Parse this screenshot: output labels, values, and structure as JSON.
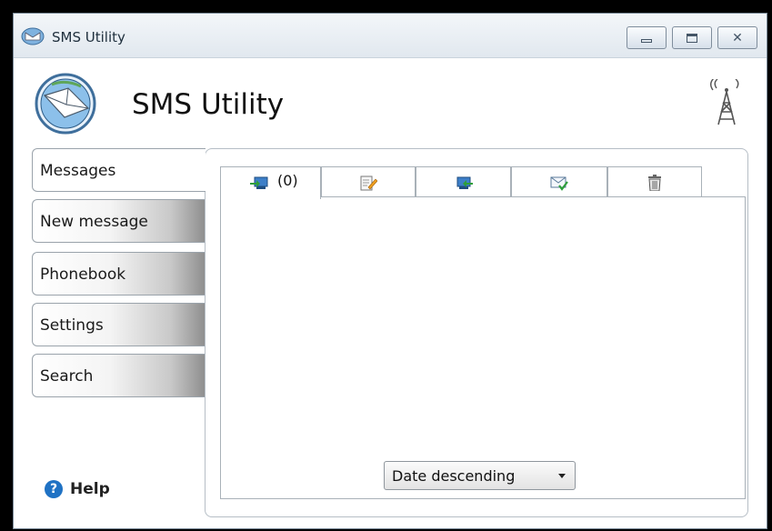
{
  "window": {
    "title": "SMS Utility",
    "controls": [
      "minimize-icon",
      "maximize-icon",
      "close-icon"
    ]
  },
  "header": {
    "app_title": "SMS Utility",
    "logo_icon": "envelope-globe-icon",
    "signal_icon": "signal-tower-icon"
  },
  "sidebar": {
    "items": [
      {
        "label": "Messages",
        "active": true
      },
      {
        "label": "New message",
        "active": false
      },
      {
        "label": "Phonebook",
        "active": false
      },
      {
        "label": "Settings",
        "active": false
      },
      {
        "label": "Search",
        "active": false
      }
    ],
    "help_label": "Help",
    "help_icon": "help-icon"
  },
  "messages": {
    "tabs": [
      {
        "icon": "inbox-icon",
        "count": "(0)",
        "active": true
      },
      {
        "icon": "drafts-icon",
        "active": false
      },
      {
        "icon": "outbox-icon",
        "active": false
      },
      {
        "icon": "sent-icon",
        "active": false
      },
      {
        "icon": "trash-icon",
        "active": false
      }
    ],
    "sort": {
      "selected": "Date descending"
    }
  },
  "colors": {
    "accent_blue": "#1f72c4",
    "icon_green": "#2e9e3a",
    "icon_orange": "#f0a020"
  }
}
